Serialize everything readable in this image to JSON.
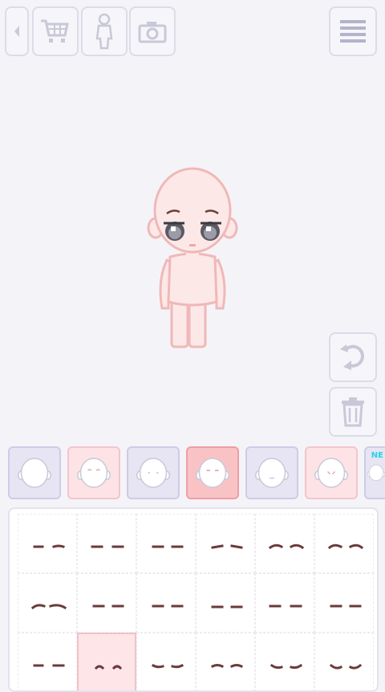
{
  "toolbar": {
    "left": [
      {
        "name": "back-arrow-button",
        "icon": "back-arrow-icon"
      },
      {
        "name": "shop-button",
        "icon": "shopping-cart-icon"
      },
      {
        "name": "character-button",
        "icon": "person-outline-icon"
      },
      {
        "name": "camera-button",
        "icon": "camera-icon"
      }
    ],
    "right": {
      "name": "menu-button",
      "icon": "hamburger-menu-icon"
    }
  },
  "side_buttons": [
    {
      "name": "rotate-button",
      "icon": "rotate-arrow-icon"
    },
    {
      "name": "trash-button",
      "icon": "trash-can-icon"
    }
  ],
  "category_tabs": [
    {
      "name": "tab-face-1",
      "style": "lav"
    },
    {
      "name": "tab-face-2",
      "style": "pink"
    },
    {
      "name": "tab-face-3",
      "style": "lav"
    },
    {
      "name": "tab-face-4",
      "style": "active"
    },
    {
      "name": "tab-face-5",
      "style": "lav"
    },
    {
      "name": "tab-face-6",
      "style": "pink"
    },
    {
      "name": "tab-face-7",
      "style": "lav",
      "badge": "NE"
    }
  ],
  "eyebrow_options": {
    "rows": 3,
    "cols": 6,
    "selected_index": 13
  },
  "colors": {
    "background": "#f4f4f8",
    "skin": "#fde8e8",
    "outline": "#f0b8b8",
    "icon_line": "#c8c8d8",
    "menu_lines": "#b3b3cc",
    "active_tab": "#f9c3c6"
  }
}
